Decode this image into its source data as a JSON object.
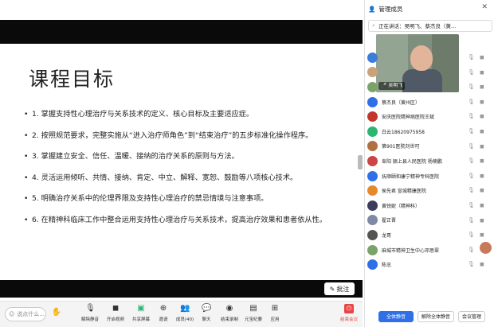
{
  "slide": {
    "title": "课程目标",
    "bullets": [
      "1. 掌握支持性心理治疗与关系技术的定义、核心目标及主要适应症。",
      "2. 按照规范要求，完整实施从“进入治疗师角色”到“结束治疗”的五步标准化操作程序。",
      "3. 掌握建立安全、信任、温暖、接纳的治疗关系的原则与方法。",
      "4. 灵活运用倾听、共情、接纳、肯定、中立、解释、宽恕、鼓励等八项核心技术。",
      "5. 明确治疗关系中的伦理界限及支持性心理治疗的禁忌情境与注意事项。",
      "6. 在精神科临床工作中整合运用支持性心理治疗与关系技术，提高治疗效果和患者依从性。"
    ],
    "annotate_label": "批注"
  },
  "toolbar": {
    "say_placeholder": "说点什么...",
    "items": [
      {
        "label": "解除静音",
        "icon": "mic-muted-icon"
      },
      {
        "label": "开启视频",
        "icon": "video-off-icon"
      },
      {
        "label": "共享屏幕",
        "icon": "share-screen-icon"
      },
      {
        "label": "邀请",
        "icon": "invite-icon"
      },
      {
        "label": "成员(40)",
        "icon": "members-icon"
      },
      {
        "label": "聊天",
        "icon": "chat-icon"
      },
      {
        "label": "结束录制",
        "icon": "record-icon"
      },
      {
        "label": "元宝纪要",
        "icon": "notes-icon"
      },
      {
        "label": "应用",
        "icon": "apps-icon"
      }
    ],
    "leave_label": "结束会议"
  },
  "panel": {
    "title": "管理成员",
    "search_placeholder": "搜索成员",
    "speaking_text": "正在讲话：吴明飞、蔡杰良（黄...",
    "video_tag": "吴明飞",
    "members": [
      {
        "name": "",
        "color": "#3b7dd8"
      },
      {
        "name": "",
        "color": "#c9a27a"
      },
      {
        "name": "",
        "color": "#7aa36a"
      },
      {
        "name": "蔡杰良（黄州区）",
        "color": "#2f6fe8"
      },
      {
        "name": "安庆医院精神病医院王斌",
        "color": "#c0392b"
      },
      {
        "name": "白云18620975958",
        "color": "#2bb673"
      },
      {
        "name": "第901医院刘世可",
        "color": "#b07040"
      },
      {
        "name": "阜阳 颍上县人民医院 杨楠鹏",
        "color": "#c44"
      },
      {
        "name": "抚顺颐和康宁精神专科医院",
        "color": "#2f6fe8"
      },
      {
        "name": "侯先君 宣城精康医院",
        "color": "#e58a2c"
      },
      {
        "name": "黄锐妮（精神科）",
        "color": "#3b3b5c"
      },
      {
        "name": "翟正晋",
        "color": "#7d8aa5"
      },
      {
        "name": "龙哥",
        "color": "#555"
      },
      {
        "name": "麻城市精神卫生中心邓思翠",
        "color": "#7aa36a"
      },
      {
        "name": "陈忠",
        "color": "#2f6fe8"
      }
    ],
    "btn_mute_all": "全体静音",
    "btn_unmute_all": "解除全体静音",
    "btn_manage": "会议管理"
  },
  "colors": {
    "accent": "#2f6fe8",
    "danger": "#e84646"
  }
}
